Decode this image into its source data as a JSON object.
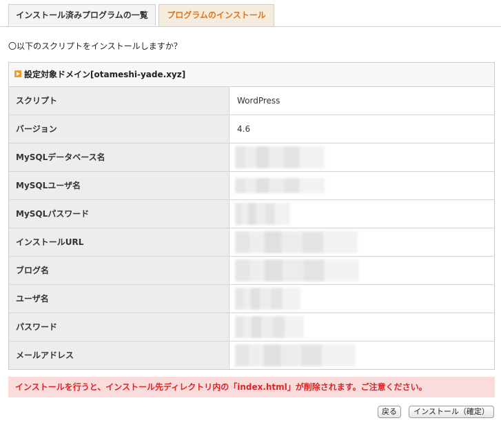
{
  "tabs": [
    {
      "label": "インストール済みプログラムの一覧",
      "active": false
    },
    {
      "label": "プログラムのインストール",
      "active": true
    }
  ],
  "prompt": "〇以下のスクリプトをインストールしますか？",
  "panel": {
    "title": "設定対象ドメイン[otameshi-yade.xyz]",
    "rows": [
      {
        "label": "スクリプト",
        "value": "WordPress"
      },
      {
        "label": "バージョン",
        "value": "4.6"
      },
      {
        "label": "MySQLデータベース名",
        "value": ""
      },
      {
        "label": "MySQLユーザ名",
        "value": ""
      },
      {
        "label": "MySQLパスワード",
        "value": ""
      },
      {
        "label": "インストールURL",
        "value": ""
      },
      {
        "label": "ブログ名",
        "value": ""
      },
      {
        "label": "ユーザ名",
        "value": ""
      },
      {
        "label": "パスワード",
        "value": ""
      },
      {
        "label": "メールアドレス",
        "value": ""
      }
    ]
  },
  "warning": "インストールを行うと、インストール先ディレクトリ内の「index.html」が削除されます。ご注意ください。",
  "buttons": {
    "back": "戻る",
    "install": "インストール（確定）"
  },
  "colors": {
    "accent": "#e2731b",
    "warning_text": "#e02222",
    "warning_bg": "#fbdcdc"
  }
}
